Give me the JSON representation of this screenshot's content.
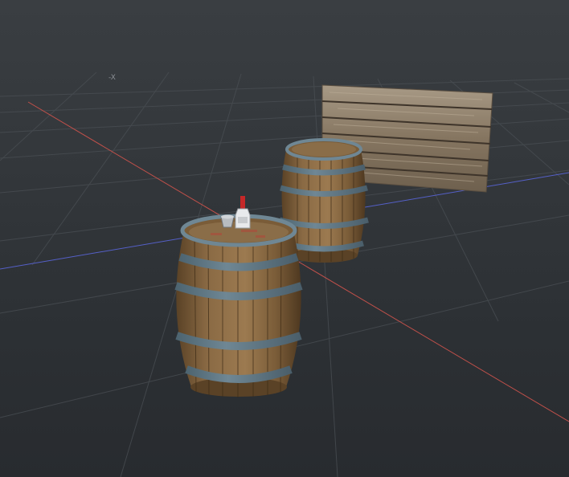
{
  "viewport": {
    "axis_label_negative_x": "-X",
    "colors": {
      "background_top": "#3a3e42",
      "background_bottom": "#282b2f",
      "grid_line": "#4a4f54",
      "axis_x": "#c0504a",
      "axis_z": "#5560c8",
      "wood_stave": "#8a6a44",
      "metal_hoop": "#6f8794",
      "hoop_highlight": "#9ab0d8",
      "wall_plank": "#9c8e7c"
    },
    "objects": [
      {
        "name": "barrel-front",
        "type": "wooden barrel"
      },
      {
        "name": "barrel-back",
        "type": "wooden barrel"
      },
      {
        "name": "wooden-wall-panel",
        "type": "wooden plank panel"
      },
      {
        "name": "bottle",
        "type": "bottle with red cap"
      },
      {
        "name": "cup",
        "type": "metal cup"
      }
    ]
  }
}
